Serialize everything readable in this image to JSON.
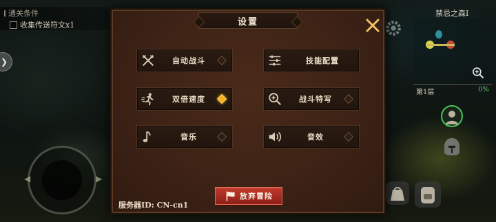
{
  "quest": {
    "title": "通关条件",
    "objective": "收集传送符文x1"
  },
  "hud": {
    "zone": "禁忌之森I",
    "floor": "第1层",
    "progress_pct": "0%"
  },
  "dialog": {
    "title": "设置",
    "options": [
      {
        "label": "自动战斗",
        "icon": "crossed-axes-icon",
        "enabled": false
      },
      {
        "label": "技能配置",
        "icon": "sliders-icon",
        "enabled": false
      },
      {
        "label": "双倍速度",
        "icon": "running-icon",
        "enabled": true
      },
      {
        "label": "战斗特写",
        "icon": "magnify-plus-icon",
        "enabled": false
      },
      {
        "label": "音乐",
        "icon": "music-note-icon",
        "enabled": false
      },
      {
        "label": "音效",
        "icon": "speaker-icon",
        "enabled": false
      }
    ],
    "server_label": "服务器ID: CN-cn1",
    "abandon_label": "放弃冒险"
  },
  "colors": {
    "toggle_on": "#f4b11d",
    "abandon_button": "#a82a20",
    "progress_green": "#5ec26a"
  }
}
